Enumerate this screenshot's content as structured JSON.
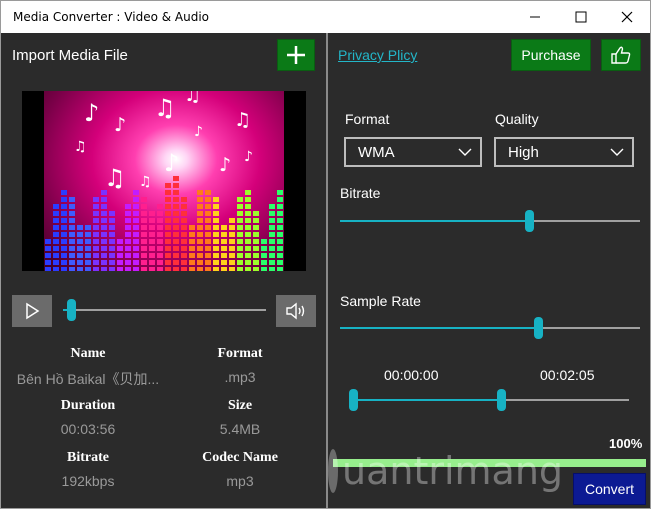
{
  "window": {
    "title": "Media Converter : Video & Audio"
  },
  "left": {
    "import_label": "Import Media File",
    "add_icon": "plus-icon",
    "seek_position_fraction": 0.04,
    "info": {
      "name_key": "Name",
      "name_value": "Bên Hồ Baikal《贝加...",
      "format_key": "Format",
      "format_value": ".mp3",
      "duration_key": "Duration",
      "duration_value": "00:03:56",
      "size_key": "Size",
      "size_value": "5.4MB",
      "bitrate_key": "Bitrate",
      "bitrate_value": "192kbps",
      "codec_key": "Codec Name",
      "codec_value": "mp3"
    }
  },
  "right": {
    "privacy_label": "Privacy Plicy",
    "purchase_label": "Purchase",
    "like_icon": "thumbs-up-icon",
    "format_label": "Format",
    "format_value": "WMA",
    "quality_label": "Quality",
    "quality_value": "High",
    "bitrate_label": "Bitrate",
    "bitrate_level": 0.63,
    "sample_rate_label": "Sample Rate",
    "sample_rate_level": 0.66,
    "trim_start": "00:00:00",
    "trim_end": "00:02:05",
    "progress_label": "100%",
    "progress_fraction": 1.0,
    "convert_label": "Convert",
    "watermark_text": "uantrimang"
  },
  "colors": {
    "accent_green": "#0b7a17",
    "accent_cyan": "#17b2c4",
    "convert_blue": "#0c1a93",
    "progress_green": "#97ee8d"
  }
}
